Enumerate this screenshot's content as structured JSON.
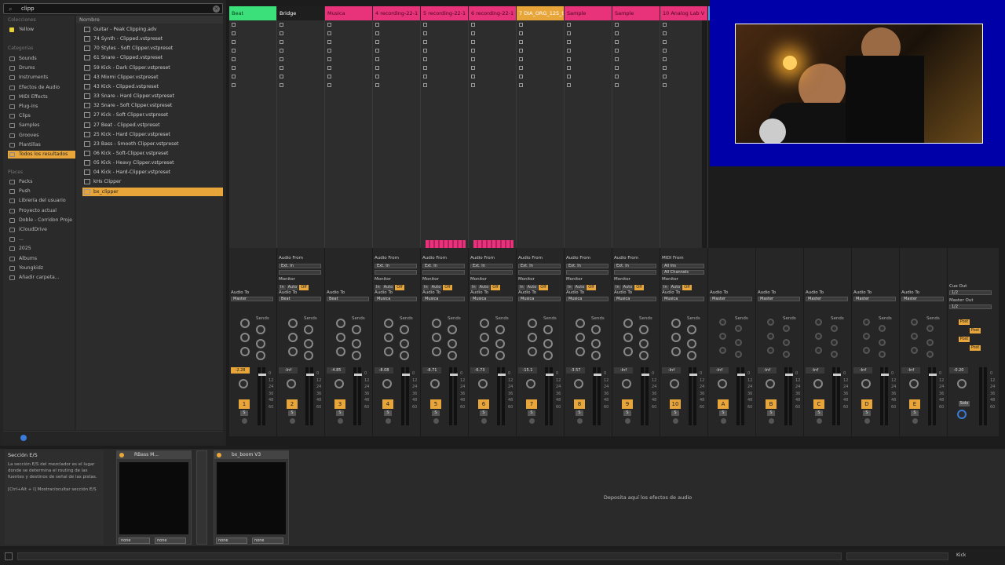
{
  "search": {
    "value": "clipp"
  },
  "sidebar": {
    "collections_label": "Colecciones",
    "collections": [
      {
        "label": "Yellow"
      }
    ],
    "categories_label": "Categorías",
    "categories": [
      {
        "label": "Sounds"
      },
      {
        "label": "Drums"
      },
      {
        "label": "Instruments"
      },
      {
        "label": "Efectos de Audio"
      },
      {
        "label": "MIDI Effects"
      },
      {
        "label": "Plug-ins"
      },
      {
        "label": "Clips"
      },
      {
        "label": "Samples"
      },
      {
        "label": "Grooves"
      },
      {
        "label": "Plantillas"
      },
      {
        "label": "Todos los resultados"
      }
    ],
    "places_label": "Places",
    "places": [
      {
        "label": "Packs"
      },
      {
        "label": "Push"
      },
      {
        "label": "Librería del usuario"
      },
      {
        "label": "Proyecto actual"
      },
      {
        "label": "Doble - Corridon Proje"
      },
      {
        "label": "iCloudDrive"
      },
      {
        "label": "..."
      },
      {
        "label": "2025"
      },
      {
        "label": "Albums"
      },
      {
        "label": "Youngkidz"
      },
      {
        "label": "Añadir carpeta..."
      }
    ]
  },
  "files": {
    "header": "Nombre",
    "items": [
      {
        "label": "Guitar - Peak Clipping.adv"
      },
      {
        "label": "74 Synth - Clipped.vstpreset"
      },
      {
        "label": "70 Styles - Soft Clipper.vstpreset"
      },
      {
        "label": "61 Snare - Clipped.vstpreset"
      },
      {
        "label": "59 Kick - Dark Clipper.vstpreset"
      },
      {
        "label": "43 Mixmi Clipper.vstpreset"
      },
      {
        "label": "43 Kick - Clipped.vstpreset"
      },
      {
        "label": "33 Snare - Hard Clipper.vstpreset"
      },
      {
        "label": "32 Snare - Soft Clipper.vstpreset"
      },
      {
        "label": "27 Kick - Soft Clipper.vstpreset"
      },
      {
        "label": "27 Beat - Clipped.vstpreset"
      },
      {
        "label": "25 Kick - Hard Clipper.vstpreset"
      },
      {
        "label": "23 Bass - Smooth Clipper.vstpreset"
      },
      {
        "label": "06 Kick - Soft-Clipper.vstpreset"
      },
      {
        "label": "05 Kick - Heavy Clipper.vstpreset"
      },
      {
        "label": "04 Kick - Hard-Clipper.vstpreset"
      },
      {
        "label": "kHs Clipper"
      },
      {
        "label": "bx_clipper"
      }
    ]
  },
  "tracks": [
    {
      "name": "Beat",
      "color": "#3be07a",
      "num": "1",
      "vol": "-2.28",
      "in_type": "",
      "out": "Master"
    },
    {
      "name": "Bridge",
      "color": "#1e1e1e",
      "num": "2",
      "vol": "-Inf",
      "in_type": "Audio From",
      "out": "Beat"
    },
    {
      "name": "Musica",
      "color": "#e8327a",
      "num": "3",
      "vol": "-4.85",
      "in_type": "",
      "out": "Beat"
    },
    {
      "name": "4 recording-22-1",
      "color": "#e8327a",
      "num": "4",
      "vol": "-8.08",
      "in_type": "Audio From",
      "out": "Musica"
    },
    {
      "name": "5 recording-22-1",
      "color": "#e8327a",
      "num": "5",
      "vol": "-8.71",
      "in_type": "Audio From",
      "out": "Musica"
    },
    {
      "name": "6 recording-22-1",
      "color": "#e8327a",
      "num": "6",
      "vol": "-6.73",
      "in_type": "Audio From",
      "out": "Musica"
    },
    {
      "name": "7 DIA_ORG_125_t",
      "color": "#e8a63a",
      "num": "7",
      "vol": "-15.1",
      "in_type": "Audio From",
      "out": "Musica"
    },
    {
      "name": "Sample",
      "color": "#e8327a",
      "num": "8",
      "vol": "-3.57",
      "in_type": "Audio From",
      "out": "Musica"
    },
    {
      "name": "Sample",
      "color": "#e8327a",
      "num": "9",
      "vol": "-Inf",
      "in_type": "Audio From",
      "out": "Musica"
    },
    {
      "name": "10 Analog Lab V",
      "color": "#e8327a",
      "num": "10",
      "vol": "-Inf",
      "in_type": "MIDI From",
      "out": "Musica"
    }
  ],
  "returns": [
    {
      "num": "A",
      "vol": "-Inf",
      "out": "Master"
    },
    {
      "num": "B",
      "vol": "-Inf",
      "out": "Master"
    },
    {
      "num": "C",
      "vol": "-Inf",
      "out": "Master"
    },
    {
      "num": "D",
      "vol": "-Inf",
      "out": "Master"
    },
    {
      "num": "E",
      "vol": "-Inf",
      "out": "Master"
    }
  ],
  "master": {
    "vol": "-0.20",
    "cue_out_label": "Cue Out",
    "cue_out": "1/2",
    "master_out_label": "Master Out",
    "master_out": "1/2",
    "solo": "Solo"
  },
  "mixer": {
    "audio_to": "Audio To",
    "monitor": "Monitor",
    "sends": "Sends",
    "ext_in": "Ext. In",
    "in": "In",
    "auto": "Auto",
    "off": "Off",
    "all_ins": "All Ins",
    "all_channels": "All Channels",
    "post": "Post"
  },
  "info": {
    "title": "Sección E/S",
    "desc": "La sección E/S del mezclador es el lugar donde se determina el routing de las fuentes y destinos de señal de las pistas.",
    "hint": "[Ctrl+Alt + I] Mostrar/ocultar sección E/S"
  },
  "devices": [
    {
      "title": "RBass M...",
      "sel1": "none",
      "sel2": "none"
    },
    {
      "title": "bx_boom V3",
      "sel1": "none",
      "sel2": "none"
    }
  ],
  "drop": {
    "msg": "Deposita aquí los efectos de audio"
  },
  "status": {
    "right": "Kick"
  },
  "colors": {
    "accent": "#e8a63a",
    "beat": "#3be07a",
    "pink": "#e8327a",
    "webcam_frame": "#0000a8"
  }
}
